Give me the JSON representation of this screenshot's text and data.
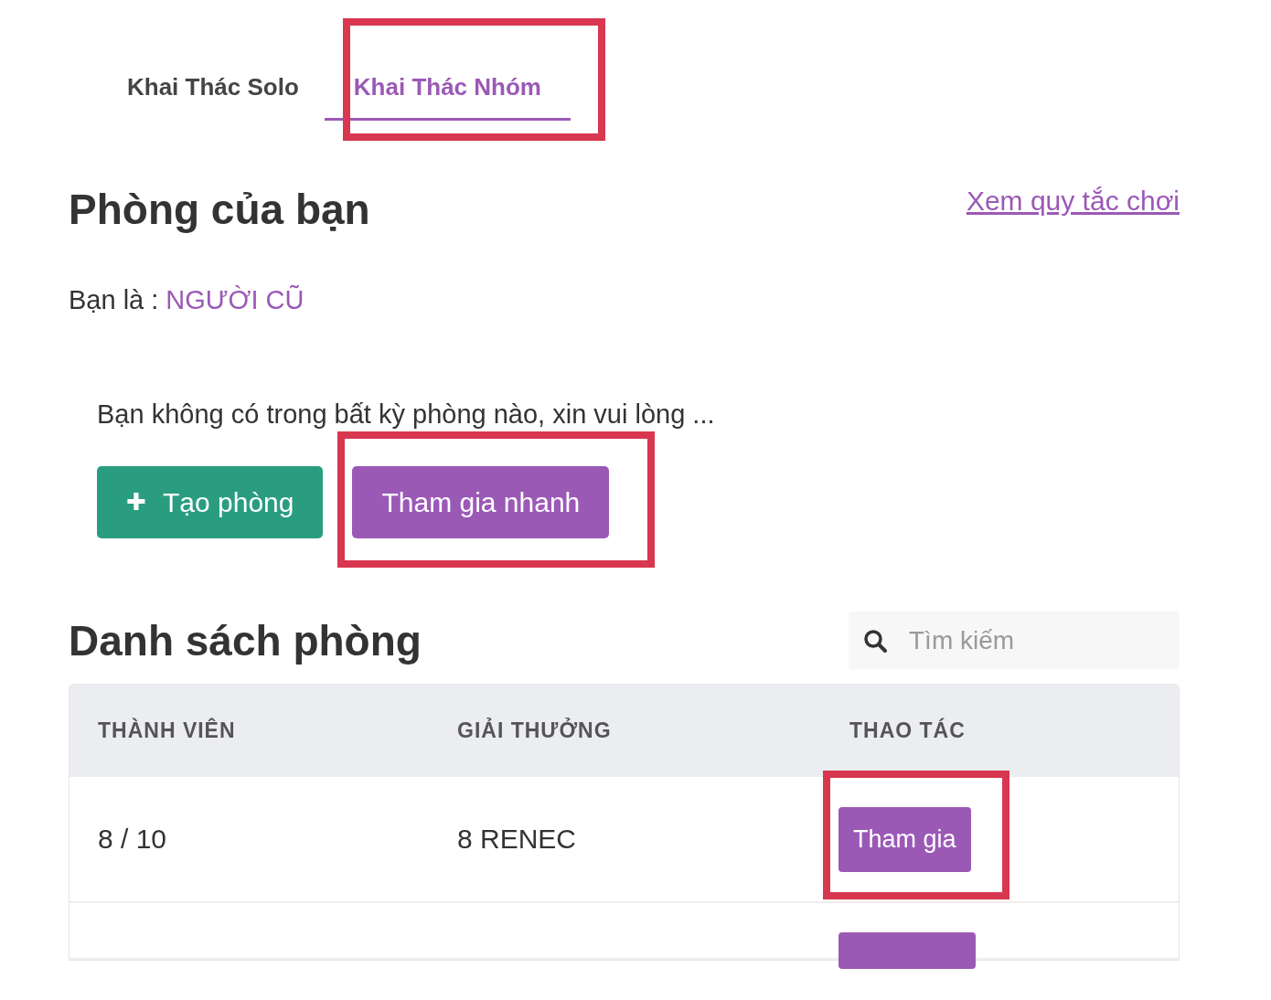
{
  "tabs": [
    {
      "label": "Khai Thác Solo",
      "selected": false,
      "highlighted": false
    },
    {
      "label": "Khai Thác Nhóm",
      "selected": true,
      "highlighted": true
    }
  ],
  "my_room": {
    "title": "Phòng của bạn",
    "rules_link": "Xem quy tắc chơi",
    "role_label": "Bạn là :",
    "role_value": "NGƯỜI CŨ",
    "message": "Bạn không có trong bất kỳ phòng nào, xin vui lòng ...",
    "buttons": [
      {
        "kind": "create",
        "icon": "✚",
        "label": "Tạo phòng",
        "highlighted": false
      },
      {
        "kind": "join",
        "label": "Tham gia nhanh",
        "highlighted": true
      }
    ]
  },
  "room_list": {
    "title": "Danh sách phòng",
    "search": {
      "placeholder": "Tìm kiếm"
    },
    "columns": [
      "THÀNH VIÊN",
      "GIẢI THƯỞNG",
      "THAO TÁC"
    ],
    "rows": [
      {
        "members": "8 / 10",
        "prize": "8 RENEC",
        "action": "Tham gia",
        "highlighted": true
      },
      {
        "kind": "cut",
        "highlighted": false
      }
    ]
  }
}
